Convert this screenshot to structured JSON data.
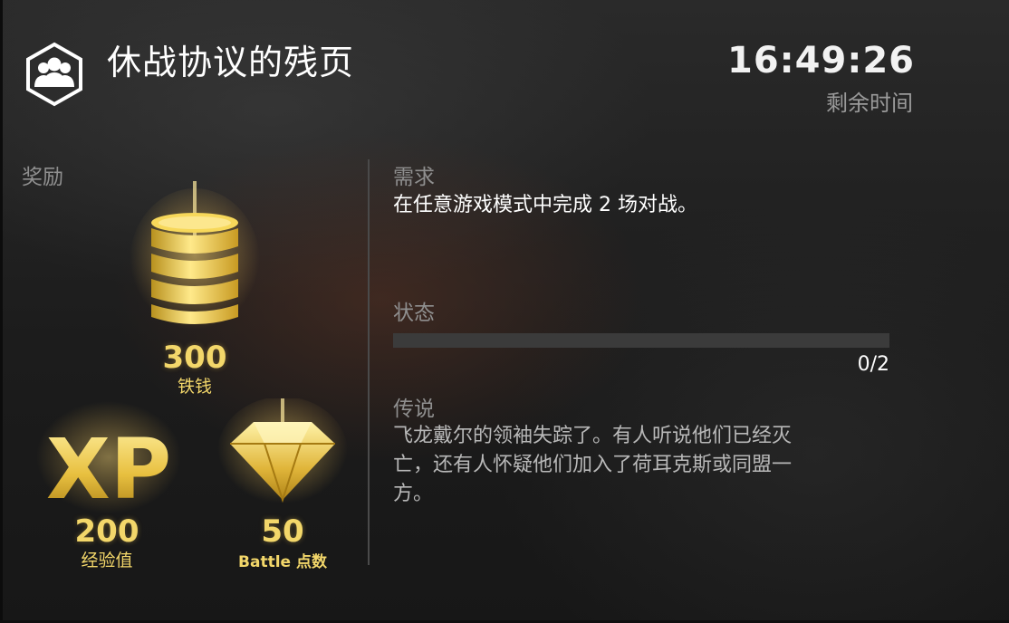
{
  "header": {
    "title": "休战协议的残页",
    "timer": "16:49:26",
    "timer_label": "剩余时间",
    "emblem_icon": "faction-group-icon"
  },
  "rewards": {
    "label": "奖励",
    "items": [
      {
        "icon": "steel-coins-icon",
        "value": "300",
        "unit": "铁钱"
      },
      {
        "icon": "xp-icon",
        "value": "200",
        "unit": "经验值"
      },
      {
        "icon": "diamond-icon",
        "value": "50",
        "unit": "Battle 点数"
      }
    ]
  },
  "requirement": {
    "label": "需求",
    "text": "在任意游戏模式中完成 2 场对战。"
  },
  "status": {
    "label": "状态",
    "progress_text": "0/2",
    "progress_fraction": 0
  },
  "lore": {
    "label": "传说",
    "lines": [
      "飞龙戴尔的领袖失踪了。有人听说他们已经灭",
      "亡，还有人怀疑他们加入了荷耳克斯或同盟一",
      "方。"
    ]
  },
  "colors": {
    "gold": "#f3d76a",
    "muted_label": "#8f8f8f"
  }
}
